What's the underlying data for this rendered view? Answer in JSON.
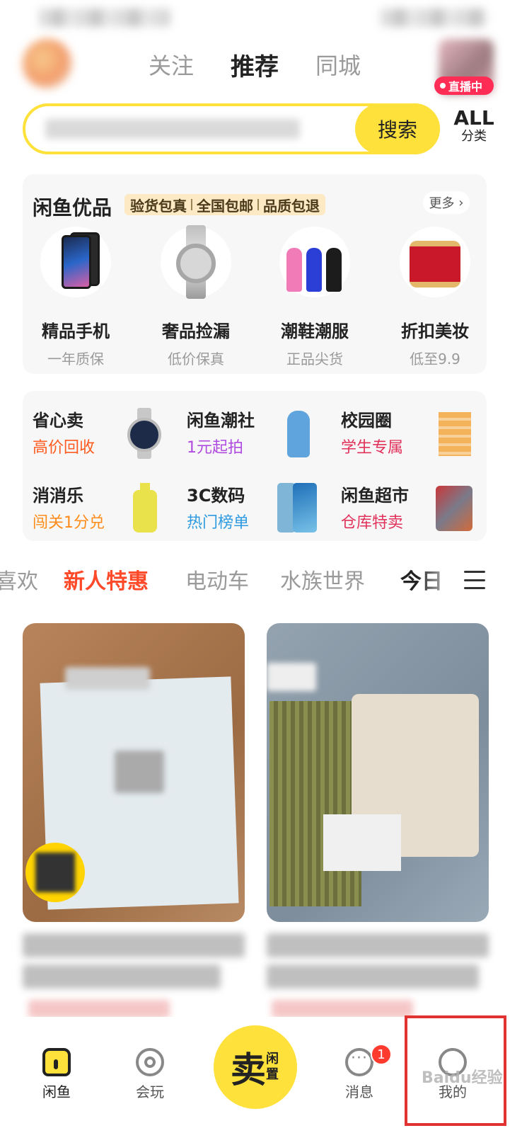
{
  "header": {
    "tabs": [
      {
        "label": "关注",
        "active": false
      },
      {
        "label": "推荐",
        "active": true
      },
      {
        "label": "同城",
        "active": false
      }
    ],
    "live_badge": "直播中"
  },
  "search": {
    "button": "搜索",
    "all_categories_big": "ALL",
    "all_categories_small": "分类"
  },
  "premium": {
    "title": "闲鱼优品",
    "tags": [
      "验货包真",
      "全国包邮",
      "品质包退"
    ],
    "more": "更多",
    "items": [
      {
        "name": "精品手机",
        "sub": "一年质保",
        "icon": "phone-icon"
      },
      {
        "name": "奢品捡漏",
        "sub": "低价保真",
        "icon": "watch-icon"
      },
      {
        "name": "潮鞋潮服",
        "sub": "正品尖货",
        "icon": "figure-icon"
      },
      {
        "name": "折扣美妆",
        "sub": "低至9.9",
        "icon": "cosmetics-icon"
      }
    ]
  },
  "features": [
    {
      "title": "省心卖",
      "sub": "高价回收",
      "color": "#ff5a1f"
    },
    {
      "title": "闲鱼潮社",
      "sub": "1元起拍",
      "color": "#b04be0"
    },
    {
      "title": "校园圈",
      "sub": "学生专属",
      "color": "#e0325a"
    },
    {
      "title": "消消乐",
      "sub": "闯关1分兑",
      "color": "#ff8c1a"
    },
    {
      "title": "3C数码",
      "sub": "热门榜单",
      "color": "#2e9be0"
    },
    {
      "title": "闲鱼超市",
      "sub": "仓库特卖",
      "color": "#e0325a"
    }
  ],
  "categories": [
    {
      "label": "喜欢",
      "active": false
    },
    {
      "label": "新人特惠",
      "active": true
    },
    {
      "label": "电动车",
      "active": false
    },
    {
      "label": "水族世界",
      "active": false
    },
    {
      "label": "今日",
      "active": false
    }
  ],
  "bottom_nav": {
    "home": "闲鱼",
    "play": "会玩",
    "sell_main": "卖",
    "sell_side": "闲置",
    "messages": "消息",
    "messages_badge": "1",
    "me": "我的"
  },
  "watermark": "Baidu经验",
  "colors": {
    "brand_yellow": "#ffe13b",
    "accent_red": "#ff4a2a",
    "highlight_red": "#e23333"
  }
}
